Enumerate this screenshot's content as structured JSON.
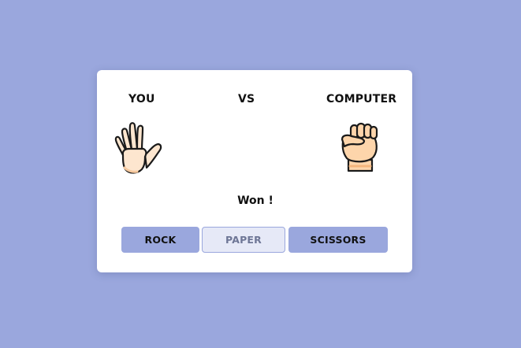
{
  "colors": {
    "background": "#9aa7dd",
    "card": "#ffffff",
    "button": "#9aa7dd",
    "button_selected": "#e6e9f7"
  },
  "scoreboard": {
    "player_label": "YOU",
    "vs_label": "VS",
    "computer_label": "COMPUTER",
    "player_choice_icon": "open-hand-icon",
    "computer_choice_icon": "raised-fist-icon"
  },
  "result": {
    "text": "Won !"
  },
  "choices": [
    {
      "label": "ROCK",
      "selected": false
    },
    {
      "label": "PAPER",
      "selected": true
    },
    {
      "label": "SCISSORS",
      "selected": false
    }
  ]
}
